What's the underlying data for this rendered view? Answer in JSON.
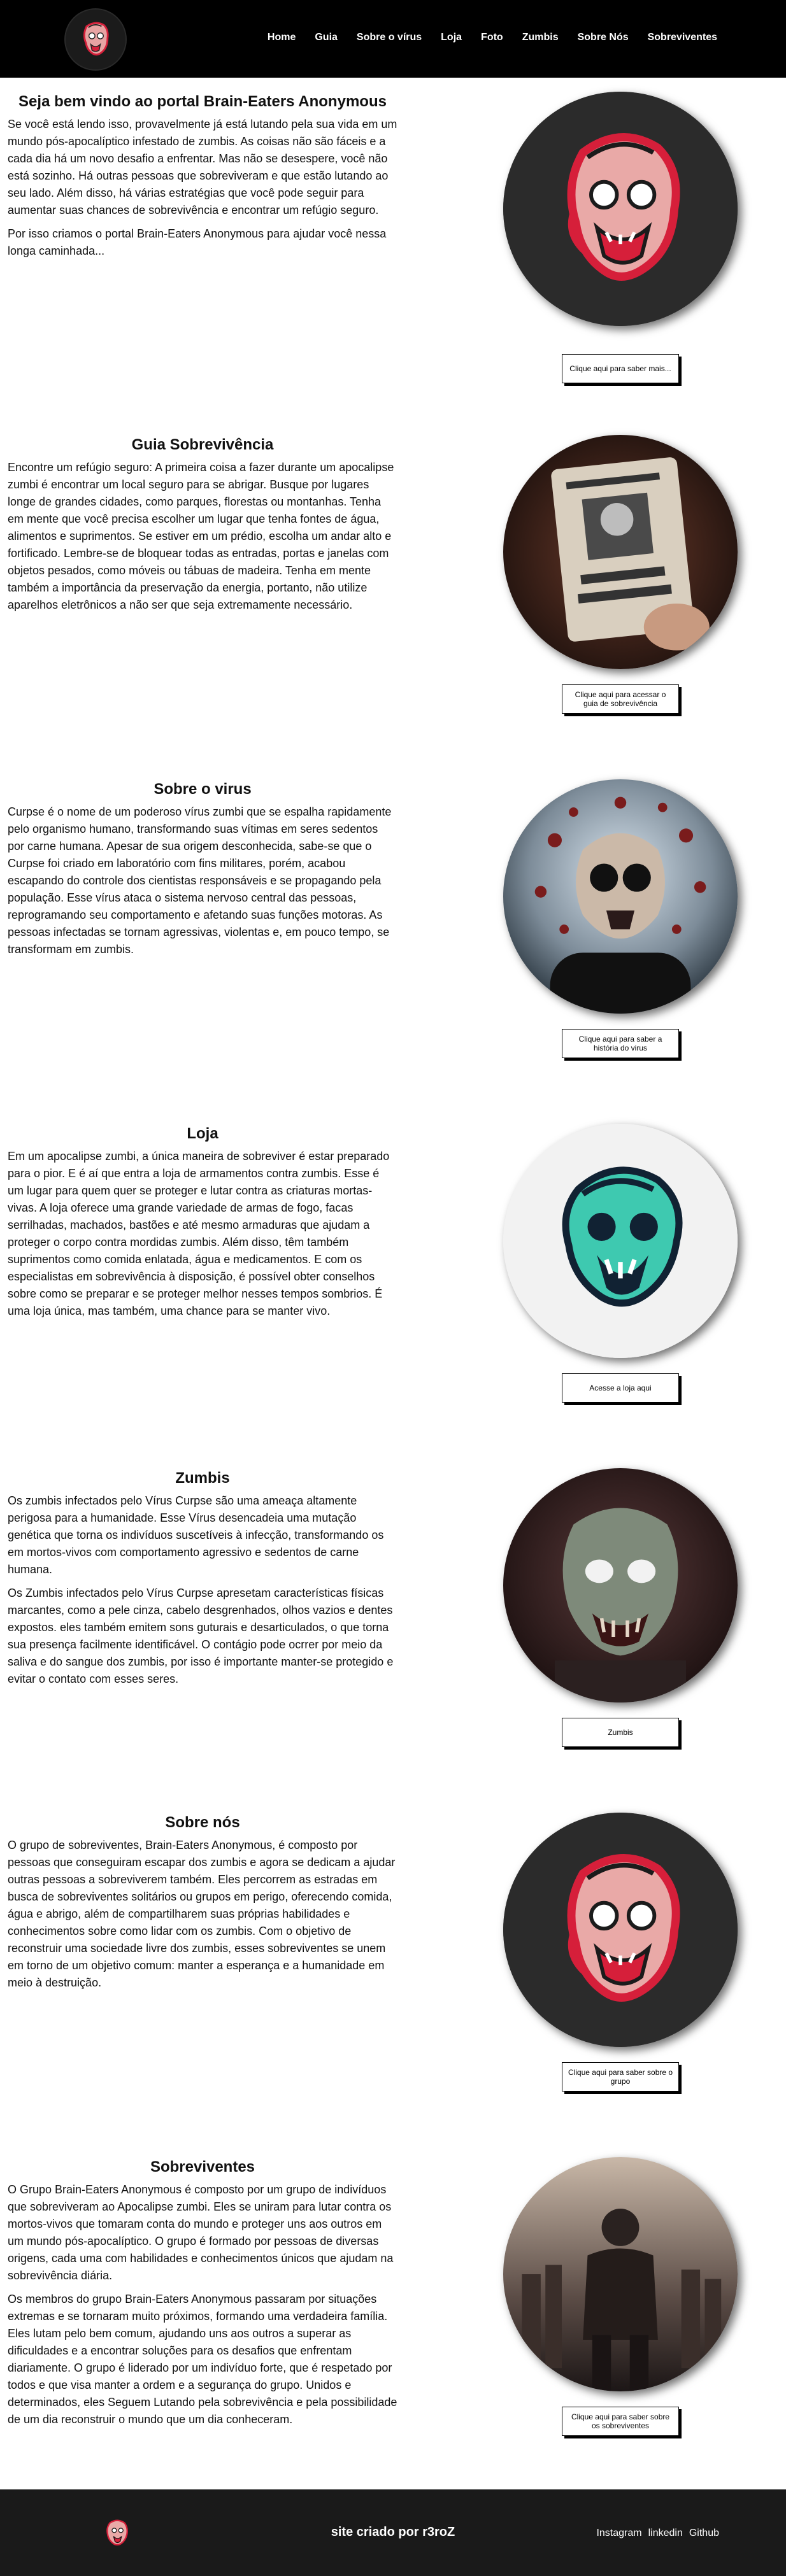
{
  "nav": {
    "items": [
      "Home",
      "Guia",
      "Sobre o vírus",
      "Loja",
      "Foto",
      "Zumbis",
      "Sobre Nós",
      "Sobreviventes"
    ]
  },
  "sections": [
    {
      "title": "Seja bem vindo ao portal Brain-Eaters Anonymous",
      "paragraphs": [
        "Se você está lendo isso, provavelmente já está lutando pela sua vida em um mundo pós-apocalíptico infestado de zumbis. As coisas não são fáceis e a cada dia há um novo desafio a enfrentar. Mas não se desespere, você não está sozinho. Há outras pessoas que sobreviveram e que estão lutando ao seu lado. Além disso, há várias estratégias que você pode seguir para aumentar suas chances de sobrevivência e encontrar um refúgio seguro.",
        "Por isso criamos o portal Brain-Eaters Anonymous para ajudar você nessa longa caminhada..."
      ],
      "button": "Clique aqui para saber mais...",
      "image": "zombie-logo-icon"
    },
    {
      "title": "Guia Sobrevivência",
      "paragraphs": [
        "Encontre um refúgio seguro: A primeira coisa a fazer durante um apocalipse zumbi é encontrar um local seguro para se abrigar. Busque por lugares longe de grandes cidades, como parques, florestas ou montanhas. Tenha em mente que você precisa escolher um lugar que tenha fontes de água, alimentos e suprimentos. Se estiver em um prédio, escolha um andar alto e fortificado. Lembre-se de bloquear todas as entradas, portas e janelas com objetos pesados, como móveis ou tábuas de madeira. Tenha em mente também a importância da preservação da energia, portanto, não utilize aparelhos eletrônicos a não ser que seja extremamente necessário."
      ],
      "button": "Clique aqui para acessar o guia de sobrevivência",
      "image": "survival-guide-book-photo"
    },
    {
      "title": "Sobre o virus",
      "paragraphs": [
        "Curpse é o nome de um poderoso vírus zumbi que se espalha rapidamente pelo organismo humano, transformando suas vítimas em seres sedentos por carne humana. Apesar de sua origem desconhecida, sabe-se que o Curpse foi criado em laboratório com fins militares, porém, acabou escapando do controle dos cientistas responsáveis e se propagando pela população. Esse vírus ataca o sistema nervoso central das pessoas, reprogramando seu comportamento e afetando suas funções motoras. As pessoas infectadas se tornam agressivas, violentas e, em pouco tempo, se transformam em zumbis."
      ],
      "button": "Clique aqui para saber a história do virus",
      "image": "virus-skull-photo"
    },
    {
      "title": "Loja",
      "paragraphs": [
        "Em um apocalipse zumbi, a única maneira de sobreviver é estar preparado para o pior. E é aí que entra a loja de armamentos contra zumbis. Esse é um lugar para quem quer se proteger e lutar contra as criaturas mortas-vivas. A loja oferece uma grande variedade de armas de fogo, facas serrilhadas, machados, bastões e até mesmo armaduras que ajudam a proteger o corpo contra mordidas zumbis. Além disso, têm também suprimentos como comida enlatada, água e medicamentos. E com os especialistas em sobrevivência à disposição, é possível obter conselhos sobre como se preparar e se proteger melhor nesses tempos sombrios. É uma loja única, mas também, uma chance para se manter vivo."
      ],
      "button": "Acesse a loja aqui",
      "image": "teal-zombie-head-icon"
    },
    {
      "title": "Zumbis",
      "paragraphs": [
        "Os zumbis infectados pelo Vírus Curpse são uma ameaça altamente perigosa para a humanidade. Esse Vírus desencadeia uma mutação genética que torna os indivíduos suscetíveis à infecção, transformando os em mortos-vivos com comportamento agressivo e sedentos de carne humana.",
        "Os Zumbis infectados pelo Vírus Curpse apresetam características físicas marcantes, como a pele cinza, cabelo desgrenhados, olhos vazios e dentes expostos. eles também emitem sons guturais e desarticulados, o que torna sua presença facilmente identificável. O contágio pode ocrrer por meio da saliva e do sangue dos zumbis, por isso é importante manter-se protegido e evitar o contato com esses seres."
      ],
      "button": "Zumbis",
      "image": "zombie-portrait-photo"
    },
    {
      "title": "Sobre nós",
      "paragraphs": [
        "O grupo de sobreviventes, Brain-Eaters Anonymous, é composto por pessoas que conseguiram escapar dos zumbis e agora se dedicam a ajudar outras pessoas a sobreviverem também. Eles percorrem as estradas em busca de sobreviventes solitários ou grupos em perigo, oferecendo comida, água e abrigo, além de compartilharem suas próprias habilidades e conhecimentos sobre como lidar com os zumbis. Com o objetivo de reconstruir uma sociedade livre dos zumbis, esses sobreviventes se unem em torno de um objetivo comum: manter a esperança e a humanidade em meio à destruição."
      ],
      "button": "Clique aqui para saber sobre o grupo",
      "image": "zombie-logo-icon"
    },
    {
      "title": "Sobreviventes",
      "paragraphs": [
        "O Grupo Brain-Eaters Anonymous é composto por um grupo de indivíduos que sobreviveram ao Apocalipse zumbi. Eles se uniram para lutar contra os mortos-vivos que tomaram conta do mundo e proteger uns aos outros em um mundo pós-apocalíptico. O grupo é formado por pessoas de diversas origens, cada uma com habilidades e conhecimentos únicos que ajudam na sobrevivência diária.",
        "Os membros do grupo Brain-Eaters Anonymous passaram por situações extremas e se tornaram muito próximos, formando uma verdadeira família. Eles lutam pelo bem comum, ajudando uns aos outros a superar as dificuldades e a encontrar soluções para os desafios que enfrentam diariamente. O grupo é liderado por um indivíduo forte, que é respetado por todos e que visa manter a ordem e a segurança do grupo. Unidos e determinados, eles Seguem Lutando pela sobrevivência e pela possibilidade de um dia reconstruir o mundo que um dia conheceram."
      ],
      "button": "Clique aqui para saber sobre os sobreviventes",
      "image": "survivor-soldier-photo"
    }
  ],
  "footer": {
    "credit": "site criado por r3roZ",
    "links": [
      "Instagram",
      "linkedin",
      "Github"
    ]
  },
  "colors": {
    "header_bg": "#000000",
    "footer_bg": "#1a1a1a",
    "accent_red": "#d61f3a",
    "teal": "#3ec9b0"
  }
}
